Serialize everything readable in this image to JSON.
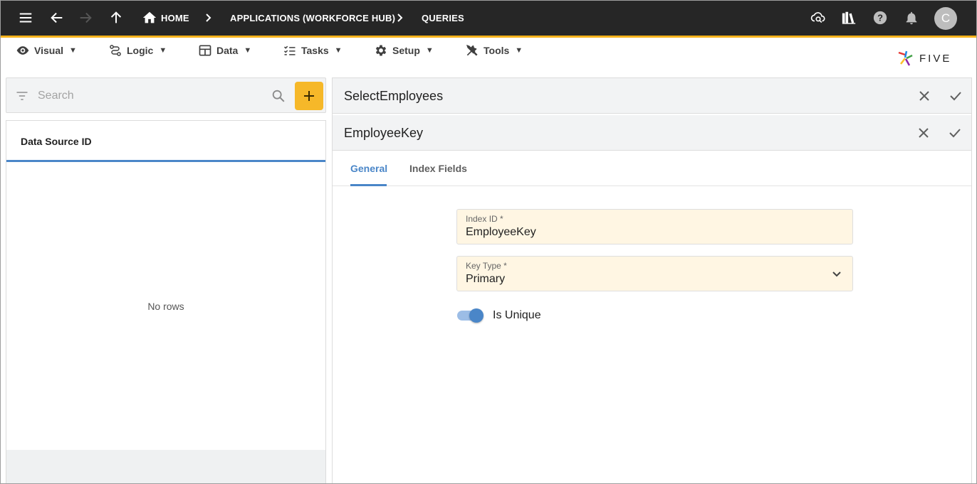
{
  "topbar": {
    "breadcrumbs": [
      "HOME",
      "APPLICATIONS (WORKFORCE HUB)",
      "QUERIES"
    ],
    "avatar_initial": "C",
    "icons": [
      "menu-icon",
      "back-arrow-icon",
      "forward-arrow-icon",
      "up-arrow-icon",
      "home-icon",
      "cloud-search-icon",
      "library-icon",
      "help-icon",
      "bell-icon"
    ],
    "accent_color": "#f5b21b"
  },
  "menubar": {
    "items": [
      {
        "label": "Visual",
        "icon": "eye-icon"
      },
      {
        "label": "Logic",
        "icon": "flow-icon"
      },
      {
        "label": "Data",
        "icon": "table-icon"
      },
      {
        "label": "Tasks",
        "icon": "checklist-icon"
      },
      {
        "label": "Setup",
        "icon": "gear-icon"
      },
      {
        "label": "Tools",
        "icon": "tools-icon"
      }
    ],
    "caret": "▼",
    "logo_text": "FIVE"
  },
  "left": {
    "search_placeholder": "Search",
    "add_label": "+",
    "column_header": "Data Source ID",
    "empty_text": "No rows"
  },
  "right": {
    "parent_title": "SelectEmployees",
    "record_title": "EmployeeKey",
    "tabs": [
      {
        "label": "General",
        "active": true
      },
      {
        "label": "Index Fields",
        "active": false
      }
    ],
    "fields": {
      "index_id": {
        "label": "Index ID *",
        "value": "EmployeeKey"
      },
      "key_type": {
        "label": "Key Type *",
        "value": "Primary"
      }
    },
    "is_unique": {
      "label": "Is Unique",
      "checked": true
    }
  },
  "colors": {
    "primary": "#4a86c8",
    "add_button": "#f6b829",
    "field_bg": "#fff6e3"
  }
}
